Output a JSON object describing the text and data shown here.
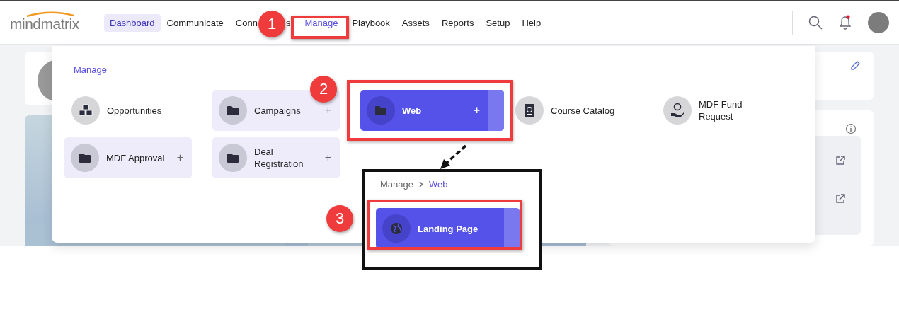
{
  "header": {
    "logo": "mindmatrix",
    "nav": [
      {
        "label": "Dashboard",
        "selected": true,
        "open": false
      },
      {
        "label": "Communicate",
        "selected": false,
        "open": false
      },
      {
        "label": "Conn",
        "label_end": "s",
        "selected": false,
        "open": false
      },
      {
        "label": "Manage",
        "selected": false,
        "open": true
      },
      {
        "label": "Playbook",
        "selected": false,
        "open": false
      },
      {
        "label": "Assets",
        "selected": false,
        "open": false
      },
      {
        "label": "Reports",
        "selected": false,
        "open": false
      },
      {
        "label": "Setup",
        "selected": false,
        "open": false
      },
      {
        "label": "Help",
        "selected": false,
        "open": false
      }
    ],
    "notifications": {
      "unread": true
    }
  },
  "menu": {
    "title": "Manage",
    "items": [
      {
        "label": "Opportunities",
        "kind": "cubes",
        "submenu": false,
        "selected": false
      },
      {
        "label": "Campaigns",
        "kind": "folder",
        "submenu": true,
        "selected": false
      },
      {
        "label": "Web",
        "kind": "folder",
        "submenu": true,
        "selected": true
      },
      {
        "label": "Course Catalog",
        "kind": "book",
        "submenu": false,
        "selected": false
      },
      {
        "label": "MDF Fund Request",
        "kind": "money",
        "submenu": false,
        "selected": false
      },
      {
        "label": "MDF Approval",
        "kind": "folder",
        "submenu": true,
        "selected": false
      },
      {
        "label": "Deal Registration",
        "kind": "folder",
        "submenu": true,
        "selected": false
      }
    ],
    "plus": "+"
  },
  "callout": {
    "breadcrumb": [
      {
        "label": "Manage",
        "current": false
      },
      {
        "label": "Web",
        "current": true
      }
    ],
    "items": [
      {
        "label": "Landing Page",
        "kind": "globe",
        "selected": true
      }
    ]
  },
  "annotations": [
    {
      "kind": "step",
      "text": "1"
    },
    {
      "kind": "step",
      "text": "2"
    },
    {
      "kind": "step",
      "text": "3"
    }
  ]
}
